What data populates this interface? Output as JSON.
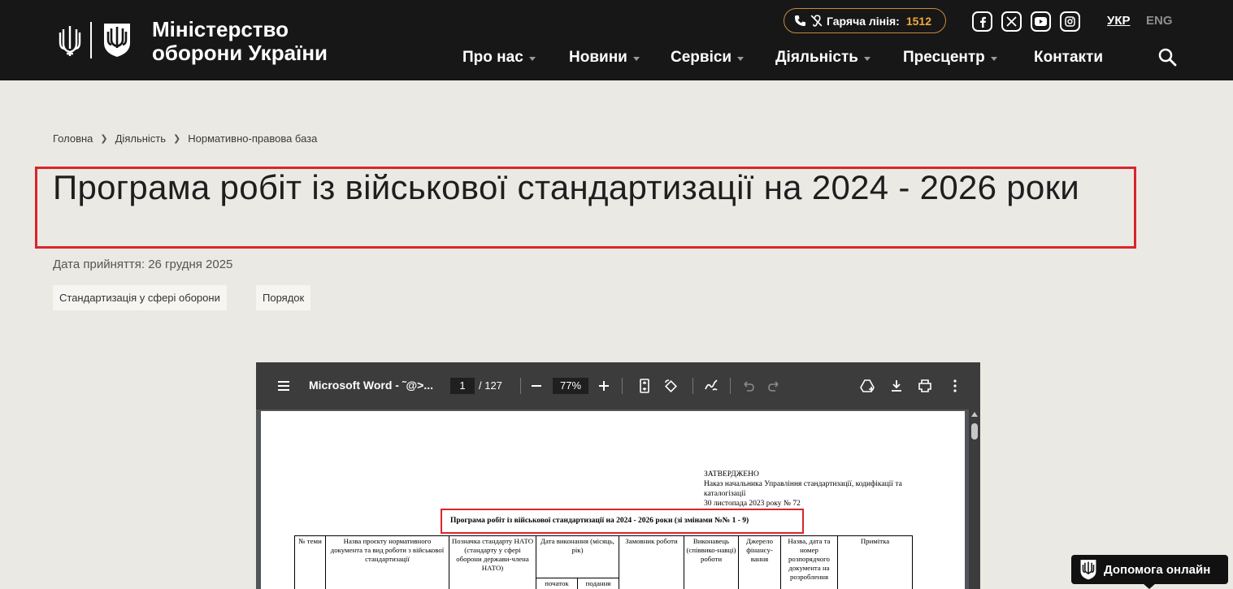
{
  "header": {
    "brand_line1": "Міністерство",
    "brand_line2": "оборони України",
    "hotline_label": "Гаряча лінія:",
    "hotline_number": "1512",
    "social_icons": [
      "facebook-icon",
      "x-icon",
      "youtube-icon",
      "instagram-icon"
    ],
    "languages": [
      {
        "label": "УКР",
        "active": true
      },
      {
        "label": "ENG",
        "active": false
      }
    ],
    "nav": [
      {
        "label": "Про нас",
        "dropdown": true
      },
      {
        "label": "Новини",
        "dropdown": true
      },
      {
        "label": "Сервіси",
        "dropdown": true
      },
      {
        "label": "Діяльність",
        "dropdown": true
      },
      {
        "label": "Пресцентр",
        "dropdown": true
      },
      {
        "label": "Контакти",
        "dropdown": false
      }
    ],
    "colors": {
      "background": "#171717",
      "accent": "#f2a93b",
      "hotline_border": "#c98a38"
    }
  },
  "breadcrumb": [
    "Головна",
    "Діяльність",
    "Нормативно-правова база"
  ],
  "page": {
    "title": "Програма робіт із військової стандартизації на 2024 - 2026 роки",
    "adopted": "Дата прийняття: 26 грудня 2025",
    "tags": [
      "Стандартизація у сфері оборони",
      "Порядок"
    ],
    "highlight_color": "#d9252b"
  },
  "pdf_viewer": {
    "doc_title": "Microsoft Word - ˜@>...",
    "current_page": "1",
    "total_pages": "/ 127",
    "zoom": "77%",
    "document": {
      "approved_lines": [
        "ЗАТВЕРДЖЕНО",
        "Наказ начальника Управління стандартизації, кодифікації та",
        "каталогізації",
        "30 листопада 2023 року № 72"
      ],
      "heading": "Програма робіт із військової стандартизації на 2024 - 2026 роки (зі змінами №№ 1 - 9)",
      "table_headers": {
        "num": "№ теми",
        "name": "Назва проєкту нормативного документа та вид роботи з військової стандартизації",
        "nato": "Позначка стандарту НАТО (стандарту у сфері оборони держави-члена НАТО)",
        "date": "Дата виконання (місяць, рік)",
        "date_start": "початок",
        "date_submit": "подання",
        "customer": "Замовник роботи",
        "executor": "Виконавець (співвико-навці) роботи",
        "funding": "Джерело фінансу-вання",
        "order": "Назва, дата та номер розпорядчого документа на розроблення",
        "note": "Примітка"
      }
    }
  },
  "help_button": {
    "label": "Допомога онлайн"
  }
}
